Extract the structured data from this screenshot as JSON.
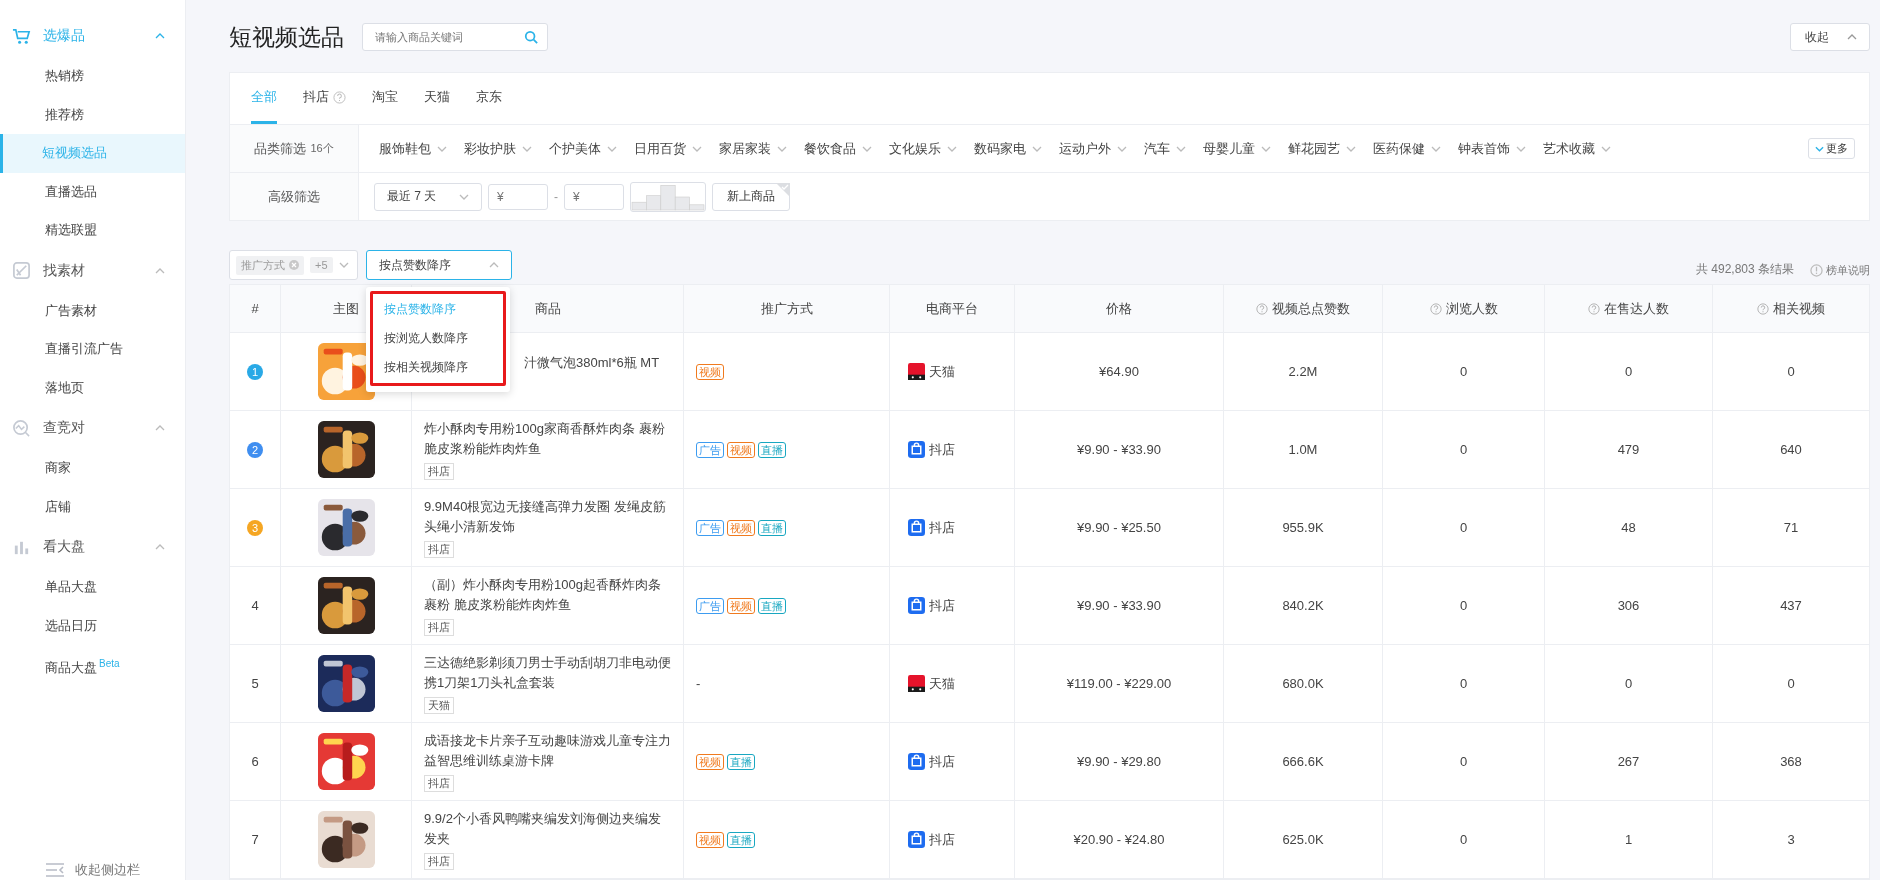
{
  "sidebar": {
    "groups": [
      {
        "label": "选爆品",
        "expanded": true,
        "items": [
          {
            "label": "热销榜",
            "selected": false
          },
          {
            "label": "推荐榜",
            "selected": false
          },
          {
            "label": "短视频选品",
            "selected": true
          },
          {
            "label": "直播选品",
            "selected": false
          },
          {
            "label": "精选联盟",
            "selected": false
          }
        ]
      },
      {
        "label": "找素材",
        "expanded": true,
        "items": [
          {
            "label": "广告素材",
            "selected": false
          },
          {
            "label": "直播引流广告",
            "selected": false
          },
          {
            "label": "落地页",
            "selected": false
          }
        ]
      },
      {
        "label": "查竞对",
        "expanded": true,
        "items": [
          {
            "label": "商家",
            "selected": false
          },
          {
            "label": "店铺",
            "selected": false
          }
        ]
      },
      {
        "label": "看大盘",
        "expanded": true,
        "items": [
          {
            "label": "单品大盘",
            "selected": false
          },
          {
            "label": "选品日历",
            "selected": false
          },
          {
            "label": "商品大盘",
            "badge": "Beta",
            "selected": false
          }
        ]
      }
    ],
    "collapse": "收起侧边栏"
  },
  "header": {
    "title": "短视频选品",
    "search": {
      "placeholder": "请输入商品关键词"
    },
    "collapse_button": "收起"
  },
  "tabs": [
    {
      "label": "全部",
      "selected": true,
      "help": false
    },
    {
      "label": "抖店",
      "selected": false,
      "help": true
    },
    {
      "label": "淘宝",
      "selected": false,
      "help": false
    },
    {
      "label": "天猫",
      "selected": false,
      "help": false
    },
    {
      "label": "京东",
      "selected": false,
      "help": false
    }
  ],
  "category_filter": {
    "label": "品类筛选",
    "count": "16个",
    "items": [
      "服饰鞋包",
      "彩妆护肤",
      "个护美体",
      "日用百货",
      "家居家装",
      "餐饮食品",
      "文化娱乐",
      "数码家电",
      "运动户外",
      "汽车",
      "母婴儿童",
      "鲜花园艺",
      "医药保健",
      "钟表首饰",
      "艺术收藏"
    ],
    "more": "更多"
  },
  "advanced_filter": {
    "label": "高级筛选",
    "period": "最近 7 天",
    "price_min": {
      "placeholder": "¥"
    },
    "separator": "-",
    "price_max": {
      "placeholder": "¥"
    },
    "new_products": {
      "label": "新上商品"
    }
  },
  "toolbar": {
    "tag_select": {
      "chip": "推广方式",
      "more": "+5"
    },
    "sort_select": {
      "value": "按点赞数降序",
      "open": true,
      "options": [
        {
          "label": "按点赞数降序",
          "selected": true
        },
        {
          "label": "按浏览人数降序",
          "selected": false
        },
        {
          "label": "按相关视频降序",
          "selected": false
        }
      ]
    },
    "result_count": "共 492,803 条结果",
    "help_link": "榜单说明"
  },
  "table": {
    "columns": [
      {
        "label": "#",
        "help": false
      },
      {
        "label": "主图",
        "help": false
      },
      {
        "label": "商品",
        "help": false
      },
      {
        "label": "推广方式",
        "help": false
      },
      {
        "label": "电商平台",
        "help": false
      },
      {
        "label": "价格",
        "help": false
      },
      {
        "label": "视频总点赞数",
        "help": true
      },
      {
        "label": "浏览人数",
        "help": true
      },
      {
        "label": "在售达人数",
        "help": true
      },
      {
        "label": "相关视频",
        "help": true
      }
    ],
    "rows": [
      {
        "rank": "1",
        "color": "#29a9e6",
        "image": {
          "kind": "picture"
        },
        "product": "汁微气泡380ml*6瓶 MT",
        "partly_hidden": true,
        "promotions": [
          {
            "kind": "video",
            "label": "视频"
          }
        ],
        "platform": {
          "kind": "tmall",
          "label": "天猫"
        },
        "price": "¥64.90",
        "likes": "2.2M",
        "viewers": "0",
        "sellers": "0",
        "videos": "0"
      },
      {
        "rank": "2",
        "color": "#3f8ef0",
        "image": {
          "kind": "picture"
        },
        "product": "炸小酥肉专用粉100g家商香酥炸肉条 裹粉脆皮浆粉能炸肉炸鱼",
        "shop_tag": "抖店",
        "partly_hidden": false,
        "promotions": [
          {
            "kind": "ad",
            "label": "广告"
          },
          {
            "kind": "video",
            "label": "视频"
          },
          {
            "kind": "live",
            "label": "直播"
          }
        ],
        "platform": {
          "kind": "douyin",
          "label": "抖店"
        },
        "price": "¥9.90 - ¥33.90",
        "likes": "1.0M",
        "viewers": "0",
        "sellers": "479",
        "videos": "640"
      },
      {
        "rank": "3",
        "color": "#f5a623",
        "image": {
          "kind": "picture"
        },
        "product": "9.9M40根宽边无接缝高弹力发圈 发绳皮筋头绳小清新发饰",
        "shop_tag": "抖店",
        "partly_hidden": false,
        "promotions": [
          {
            "kind": "ad",
            "label": "广告"
          },
          {
            "kind": "video",
            "label": "视频"
          },
          {
            "kind": "live",
            "label": "直播"
          }
        ],
        "platform": {
          "kind": "douyin",
          "label": "抖店"
        },
        "price": "¥9.90 - ¥25.50",
        "likes": "955.9K",
        "viewers": "0",
        "sellers": "48",
        "videos": "71"
      },
      {
        "rank": "4",
        "image": {
          "kind": "picture"
        },
        "product": "（副）炸小酥肉专用粉100g起香酥炸肉条裹粉 脆皮浆粉能炸肉炸鱼",
        "shop_tag": "抖店",
        "partly_hidden": false,
        "promotions": [
          {
            "kind": "ad",
            "label": "广告"
          },
          {
            "kind": "video",
            "label": "视频"
          },
          {
            "kind": "live",
            "label": "直播"
          }
        ],
        "platform": {
          "kind": "douyin",
          "label": "抖店"
        },
        "price": "¥9.90 - ¥33.90",
        "likes": "840.2K",
        "viewers": "0",
        "sellers": "306",
        "videos": "437"
      },
      {
        "rank": "5",
        "image": {
          "kind": "picture"
        },
        "product": "三达德绝影剃须刀男士手动刮胡刀非电动便携1刀架1刀头礼盒套装",
        "shop_tag": "天猫",
        "partly_hidden": false,
        "no_promotion": "-",
        "promotions": [],
        "platform": {
          "kind": "tmall",
          "label": "天猫"
        },
        "price": "¥119.00 - ¥229.00",
        "likes": "680.0K",
        "viewers": "0",
        "sellers": "0",
        "videos": "0"
      },
      {
        "rank": "6",
        "image": {
          "kind": "picture"
        },
        "product": "成语接龙卡片亲子互动趣味游戏儿童专注力益智思维训练桌游卡牌",
        "shop_tag": "抖店",
        "partly_hidden": false,
        "promotions": [
          {
            "kind": "video",
            "label": "视频"
          },
          {
            "kind": "live",
            "label": "直播"
          }
        ],
        "platform": {
          "kind": "douyin",
          "label": "抖店"
        },
        "price": "¥9.90 - ¥29.80",
        "likes": "666.6K",
        "viewers": "0",
        "sellers": "267",
        "videos": "368"
      },
      {
        "rank": "7",
        "image": {
          "kind": "picture"
        },
        "product": "9.9/2个小香风鸭嘴夹编发刘海侧边夹编发发夹",
        "shop_tag": "抖店",
        "partly_hidden": false,
        "promotions": [
          {
            "kind": "video",
            "label": "视频"
          },
          {
            "kind": "live",
            "label": "直播"
          }
        ],
        "platform": {
          "kind": "douyin",
          "label": "抖店"
        },
        "price": "¥20.90 - ¥24.80",
        "likes": "625.0K",
        "viewers": "0",
        "sellers": "1",
        "videos": "3"
      }
    ]
  }
}
